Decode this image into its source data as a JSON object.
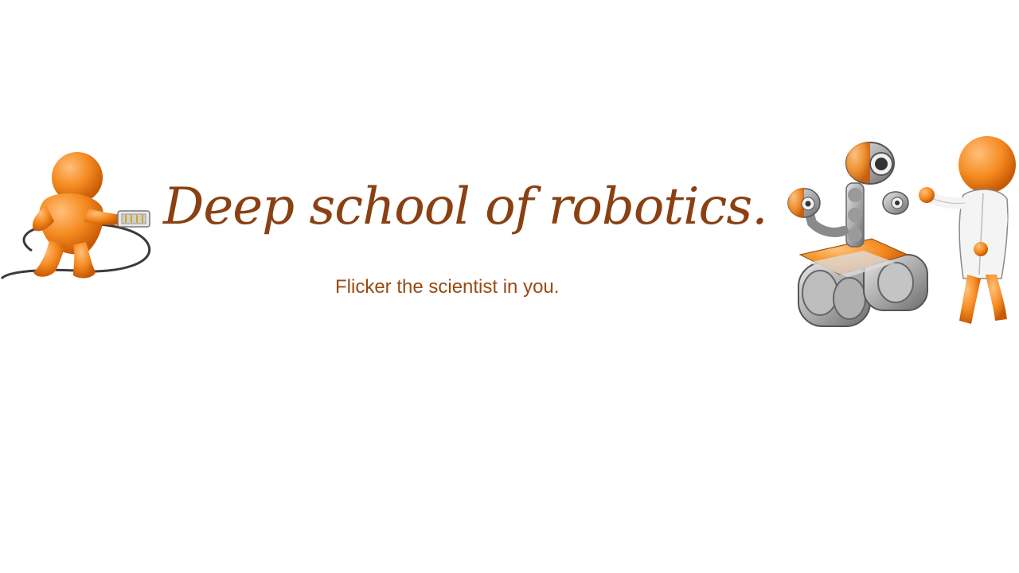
{
  "banner": {
    "title": "Deep school of robotics.",
    "tagline": "Flicker the scientist in you."
  },
  "icons": {
    "left": "figure-with-cable-icon",
    "robot": "robot-icon",
    "right": "scientist-figure-icon"
  },
  "colors": {
    "title": "#8a4012",
    "tagline": "#9a4a12",
    "figure_orange": "#f07b12",
    "robot_gray": "#9b9b9b",
    "background": "#ffffff"
  }
}
